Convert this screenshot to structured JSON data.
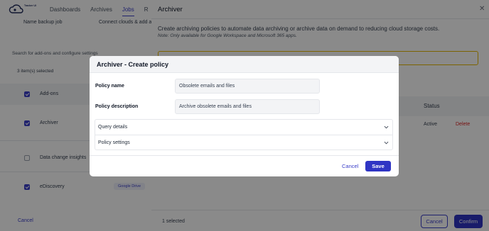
{
  "app": {
    "logo_text": "Tracker UI"
  },
  "nav": {
    "items": [
      "Dashboards",
      "Archives",
      "Jobs",
      "R"
    ],
    "active_index": 2
  },
  "job": {
    "name_label": "Name backup job",
    "connect_label": "Connect clouds & add a"
  },
  "addons": {
    "search_hint": "Search for add-ons and configure settings",
    "selected_count": "3 item(s) selected",
    "header": "Add-ons",
    "rows": [
      {
        "label": "Archiver",
        "checked": true
      },
      {
        "label": "Data change insights",
        "checked": false
      },
      {
        "label": "eDiscovery",
        "checked": true
      }
    ],
    "google_drive_pill": "Google Drive",
    "cancel": "Cancel"
  },
  "drawer": {
    "title": "Archiver",
    "description": "Create archiving policies to automate data archiving or archive data on demand to reducing cloud storage costs.",
    "note": "Note: Only available for Google Workspace and Microsoft 365 apps.",
    "status_header": "Status",
    "status_value": "Active",
    "delete": "Delete",
    "selected": "1 selected",
    "cancel": "Cancel",
    "confirm": "Confirm"
  },
  "modal": {
    "title": "Archiver - Create policy",
    "fields": [
      {
        "label": "Policy name",
        "value": "Obsolete emails and files"
      },
      {
        "label": "Policy description",
        "value": "Archive obsolete emails and files"
      }
    ],
    "sections": [
      "Query details",
      "Policy settings"
    ],
    "cancel": "Cancel",
    "save": "Save"
  },
  "colors": {
    "accent": "#2f35c4",
    "danger": "#dc2626",
    "overlay": "rgba(0,0,0,0.46)"
  }
}
